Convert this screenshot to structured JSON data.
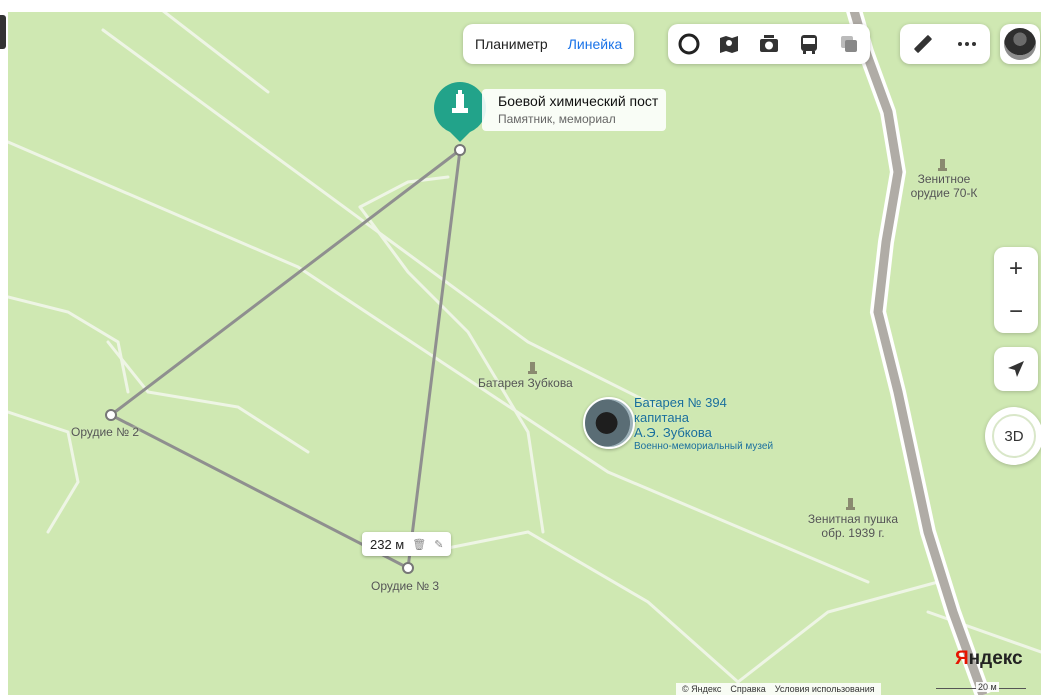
{
  "toolbar": {
    "planimeter_label": "Планиметр",
    "ruler_label": "Линейка",
    "layer_icons": [
      "circle-icon",
      "map-book-icon",
      "camera-icon",
      "bus-icon",
      "layers-icon"
    ],
    "tool_icons": [
      "ruler-icon",
      "more-icon"
    ]
  },
  "zoom": {
    "in_label": "+",
    "out_label": "−"
  },
  "compass": {
    "label": "3D"
  },
  "selected_poi": {
    "name": "Боевой химический пост",
    "category": "Памятник, мемориал"
  },
  "labels": {
    "zenith_gun_70k": "Зенитное орудие 70-К",
    "battery_zubkov": "Батарея Зубкова",
    "gun_2": "Орудие № 2",
    "gun_3": "Орудие № 3",
    "zenith_gun_1939": "Зенитная пушка обр. 1939 г."
  },
  "museum": {
    "name_line1": "Батарея № 394",
    "name_line2": "капитана",
    "name_line3": "А.Э. Зубкова",
    "category": "Военно-мемориальный музей"
  },
  "measurement": {
    "distance": "232 м"
  },
  "branding": {
    "logo_red": "Я",
    "logo_rest": "ндекс"
  },
  "footer": {
    "copyright": "© Яндекс",
    "help": "Справка",
    "terms": "Условия использования"
  },
  "scale": {
    "label": "20 м"
  },
  "colors": {
    "map_green": "#cfe8b2",
    "road_white": "#f4f8ee",
    "highway_gray": "#b0aca6",
    "accent_teal": "#22a38a",
    "link_blue": "#1a73e8"
  }
}
